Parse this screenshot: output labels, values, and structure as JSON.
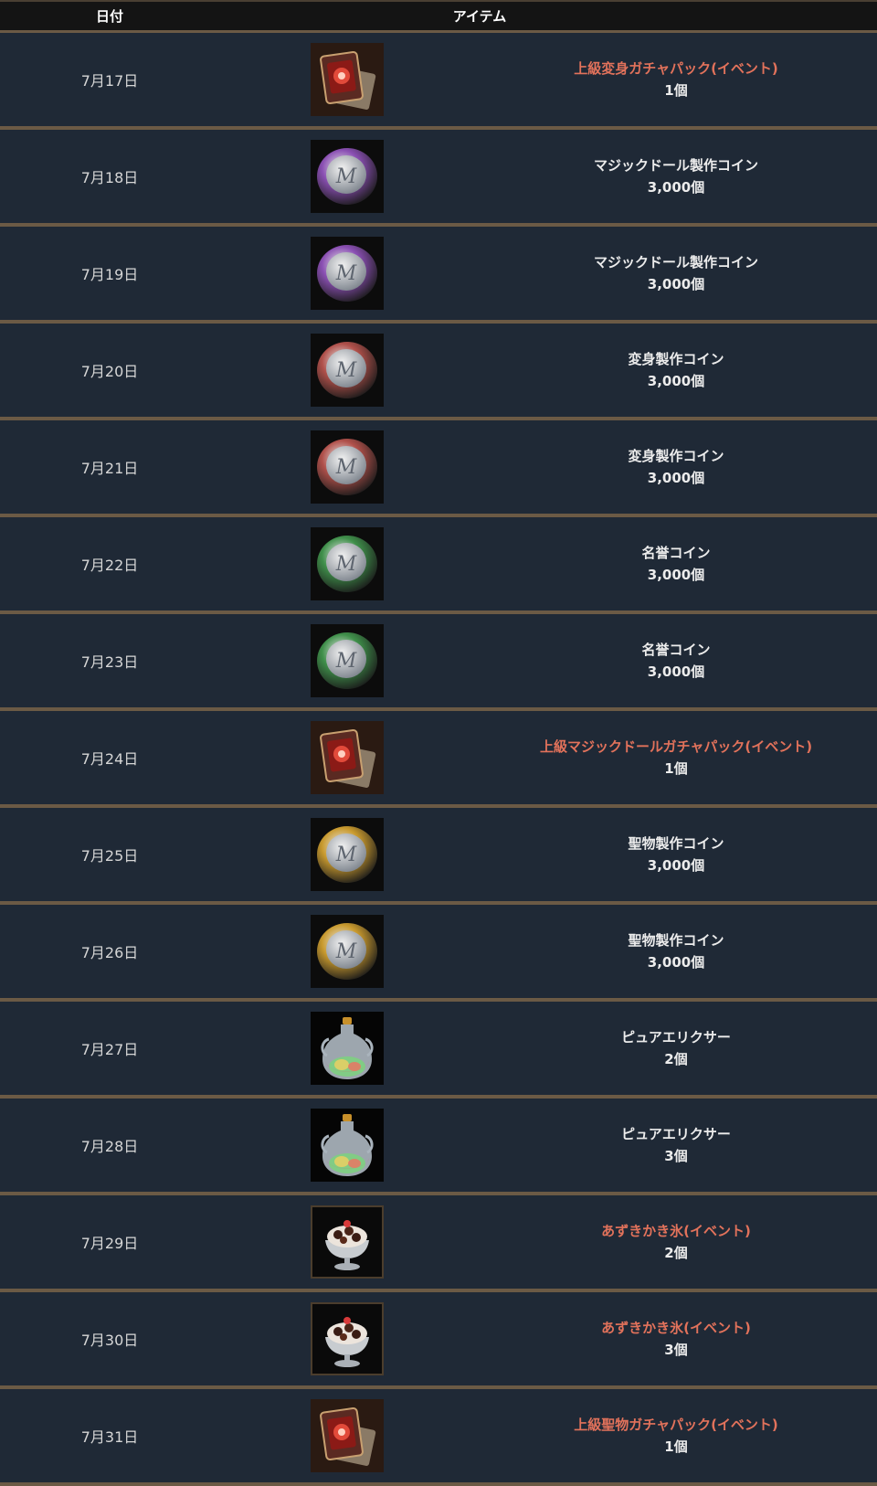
{
  "header": {
    "date_label": "日付",
    "item_label": "アイテム"
  },
  "rows": [
    {
      "date": "7月17日",
      "icon": "card-pack-icon",
      "name": "上級変身ガチャパック(イベント)",
      "qty": "1個",
      "event": true
    },
    {
      "date": "7月18日",
      "icon": "purple-coin-icon",
      "name": "マジックドール製作コイン",
      "qty": "3,000個",
      "event": false
    },
    {
      "date": "7月19日",
      "icon": "purple-coin-icon",
      "name": "マジックドール製作コイン",
      "qty": "3,000個",
      "event": false
    },
    {
      "date": "7月20日",
      "icon": "red-coin-icon",
      "name": "変身製作コイン",
      "qty": "3,000個",
      "event": false
    },
    {
      "date": "7月21日",
      "icon": "red-coin-icon",
      "name": "変身製作コイン",
      "qty": "3,000個",
      "event": false
    },
    {
      "date": "7月22日",
      "icon": "green-coin-icon",
      "name": "名誉コイン",
      "qty": "3,000個",
      "event": false
    },
    {
      "date": "7月23日",
      "icon": "green-coin-icon",
      "name": "名誉コイン",
      "qty": "3,000個",
      "event": false
    },
    {
      "date": "7月24日",
      "icon": "card-pack-icon",
      "name": "上級マジックドールガチャパック(イベント)",
      "qty": "1個",
      "event": true
    },
    {
      "date": "7月25日",
      "icon": "gold-coin-icon",
      "name": "聖物製作コイン",
      "qty": "3,000個",
      "event": false
    },
    {
      "date": "7月26日",
      "icon": "gold-coin-icon",
      "name": "聖物製作コイン",
      "qty": "3,000個",
      "event": false
    },
    {
      "date": "7月27日",
      "icon": "elixir-bottle-icon",
      "name": "ピュアエリクサー",
      "qty": "2個",
      "event": false
    },
    {
      "date": "7月28日",
      "icon": "elixir-bottle-icon",
      "name": "ピュアエリクサー",
      "qty": "3個",
      "event": false
    },
    {
      "date": "7月29日",
      "icon": "shaved-ice-icon",
      "name": "あずきかき氷(イベント)",
      "qty": "2個",
      "event": true
    },
    {
      "date": "7月30日",
      "icon": "shaved-ice-icon",
      "name": "あずきかき氷(イベント)",
      "qty": "3個",
      "event": true
    },
    {
      "date": "7月31日",
      "icon": "card-pack-icon",
      "name": "上級聖物ガチャパック(イベント)",
      "qty": "1個",
      "event": true
    }
  ],
  "colors": {
    "row_bg": "#1f2936",
    "separator": "#6b5a45",
    "event_text": "#e2725b",
    "normal_text": "#ececec",
    "purple_coin": "#8a4fb3",
    "red_coin": "#b0504a",
    "green_coin": "#3f8f4a",
    "gold_coin": "#c99a2e"
  }
}
